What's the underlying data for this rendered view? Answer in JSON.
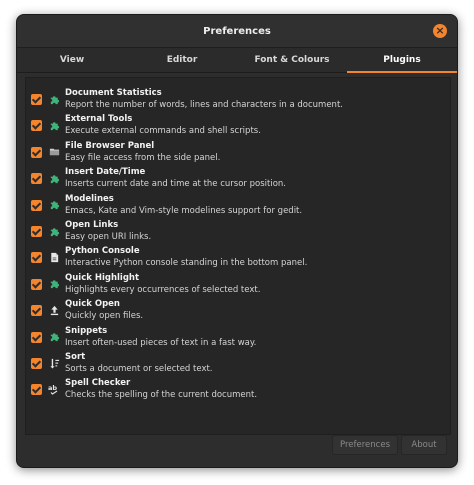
{
  "window": {
    "title": "Preferences"
  },
  "tabs": [
    {
      "label": "View"
    },
    {
      "label": "Editor"
    },
    {
      "label": "Font & Colours"
    },
    {
      "label": "Plugins"
    }
  ],
  "active_tab": "Plugins",
  "plugins": [
    {
      "name": "Document Statistics",
      "desc": "Report the number of words, lines and characters in a document.",
      "icon": "puzzle-icon",
      "enabled": true
    },
    {
      "name": "External Tools",
      "desc": "Execute external commands and shell scripts.",
      "icon": "puzzle-icon",
      "enabled": true
    },
    {
      "name": "File Browser Panel",
      "desc": "Easy file access from the side panel.",
      "icon": "folder-icon",
      "enabled": true
    },
    {
      "name": "Insert Date/Time",
      "desc": "Inserts current date and time at the cursor position.",
      "icon": "puzzle-icon",
      "enabled": true
    },
    {
      "name": "Modelines",
      "desc": "Emacs, Kate and Vim-style modelines support for gedit.",
      "icon": "puzzle-icon",
      "enabled": true
    },
    {
      "name": "Open Links",
      "desc": "Easy open URI links.",
      "icon": "puzzle-icon",
      "enabled": true
    },
    {
      "name": "Python Console",
      "desc": "Interactive Python console standing in the bottom panel.",
      "icon": "document-icon",
      "enabled": true
    },
    {
      "name": "Quick Highlight",
      "desc": "Highlights every occurrences of selected text.",
      "icon": "puzzle-icon",
      "enabled": true
    },
    {
      "name": "Quick Open",
      "desc": "Quickly open files.",
      "icon": "upload-icon",
      "enabled": true
    },
    {
      "name": "Snippets",
      "desc": "Insert often-used pieces of text in a fast way.",
      "icon": "puzzle-icon",
      "enabled": true
    },
    {
      "name": "Sort",
      "desc": "Sorts a document or selected text.",
      "icon": "sort-icon",
      "enabled": true
    },
    {
      "name": "Spell Checker",
      "desc": "Checks the spelling of the current document.",
      "icon": "spellcheck-icon",
      "enabled": true
    }
  ],
  "buttons": {
    "preferences": "Preferences",
    "about": "About"
  },
  "colors": {
    "accent": "#f5852d",
    "window_bg": "#2d2d2d",
    "puzzle_green": "#3fb37a"
  }
}
